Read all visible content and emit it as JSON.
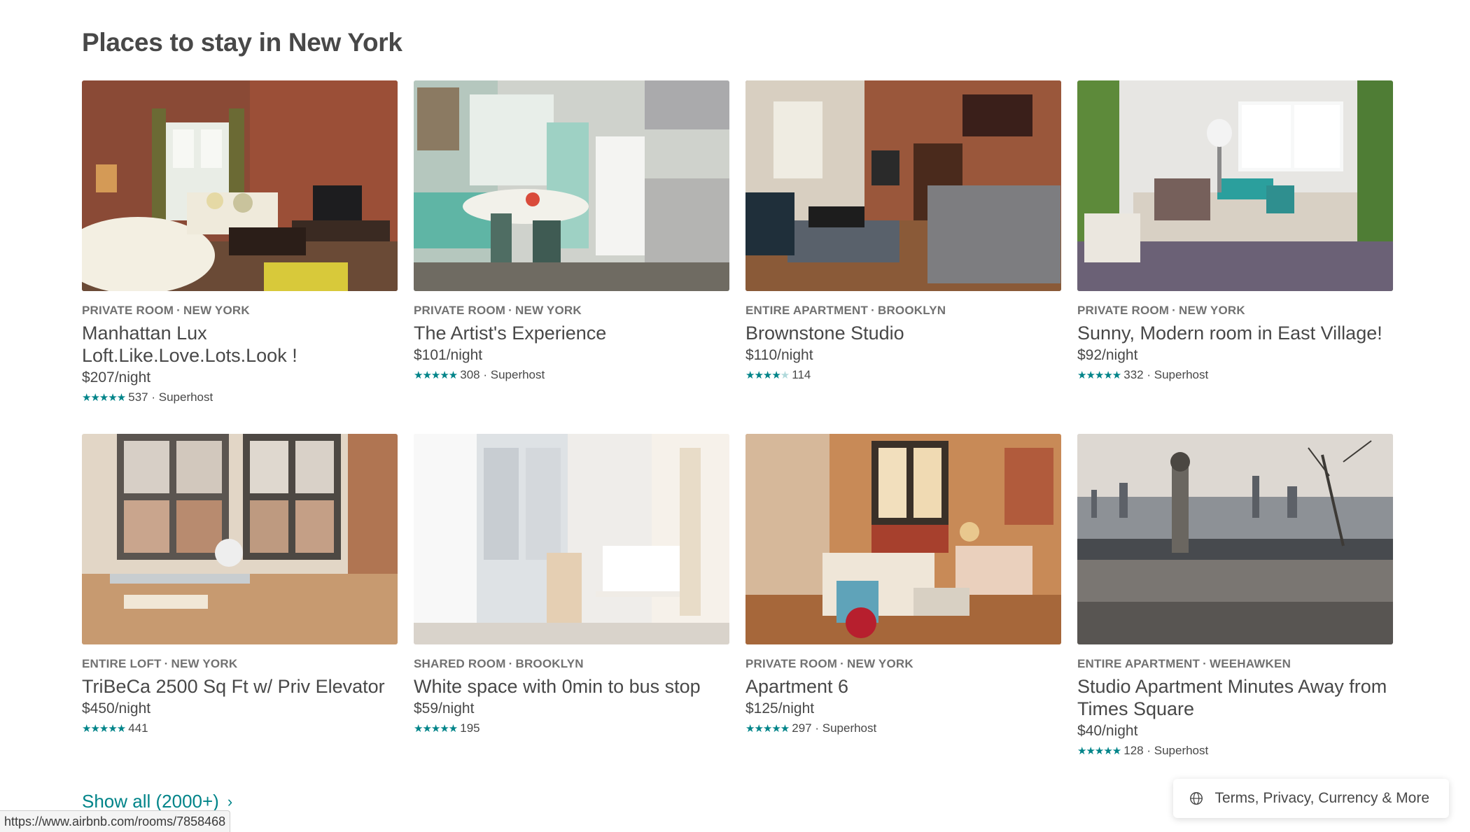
{
  "page": {
    "title": "Places to stay in New York",
    "show_all_label": "Show all (2000+)",
    "status_url": "https://www.airbnb.com/rooms/7858468",
    "footer_label": "Terms, Privacy, Currency & More"
  },
  "colors": {
    "accent_teal": "#008489",
    "text_dark": "#484848",
    "text_muted": "#717171"
  },
  "listings": [
    {
      "type": "PRIVATE ROOM",
      "location": "NEW YORK",
      "title": "Manhattan Lux Loft.Like.Love.Lots.Look !",
      "price": "$207/night",
      "stars": "★★★★★",
      "reviews": "537",
      "badge": "· Superhost",
      "photo": "living-room-brick"
    },
    {
      "type": "PRIVATE ROOM",
      "location": "NEW YORK",
      "title": "The Artist's Experience",
      "price": "$101/night",
      "stars": "★★★★★",
      "reviews": "308",
      "badge": "· Superhost",
      "photo": "teal-kitchen"
    },
    {
      "type": "ENTIRE APARTMENT",
      "location": "BROOKLYN",
      "title": "Brownstone Studio",
      "price": "$110/night",
      "stars": "★★★★",
      "stars_half": "★",
      "reviews": "114",
      "badge": "",
      "photo": "brownstone-bedroom"
    },
    {
      "type": "PRIVATE ROOM",
      "location": "NEW YORK",
      "title": "Sunny, Modern room in East Village!",
      "price": "$92/night",
      "stars": "★★★★★",
      "reviews": "332",
      "badge": "· Superhost",
      "photo": "sunny-living-room"
    },
    {
      "type": "ENTIRE LOFT",
      "location": "NEW YORK",
      "title": "TriBeCa 2500 Sq Ft w/ Priv Elevator",
      "price": "$450/night",
      "stars": "★★★★★",
      "reviews": "441",
      "badge": "",
      "photo": "loft-windows"
    },
    {
      "type": "SHARED ROOM",
      "location": "BROOKLYN",
      "title": "White space with 0min to bus stop",
      "price": "$59/night",
      "stars": "★★★★★",
      "reviews": "195",
      "badge": "",
      "photo": "white-room"
    },
    {
      "type": "PRIVATE ROOM",
      "location": "NEW YORK",
      "title": "Apartment 6",
      "price": "$125/night",
      "stars": "★★★★★",
      "reviews": "297",
      "badge": "· Superhost",
      "photo": "warm-living-room"
    },
    {
      "type": "ENTIRE APARTMENT",
      "location": "WEEHAWKEN",
      "title": "Studio Apartment Minutes Away from Times Square",
      "price": "$40/night",
      "stars": "★★★★★",
      "reviews": "128",
      "badge": "· Superhost",
      "photo": "city-skyline"
    }
  ]
}
